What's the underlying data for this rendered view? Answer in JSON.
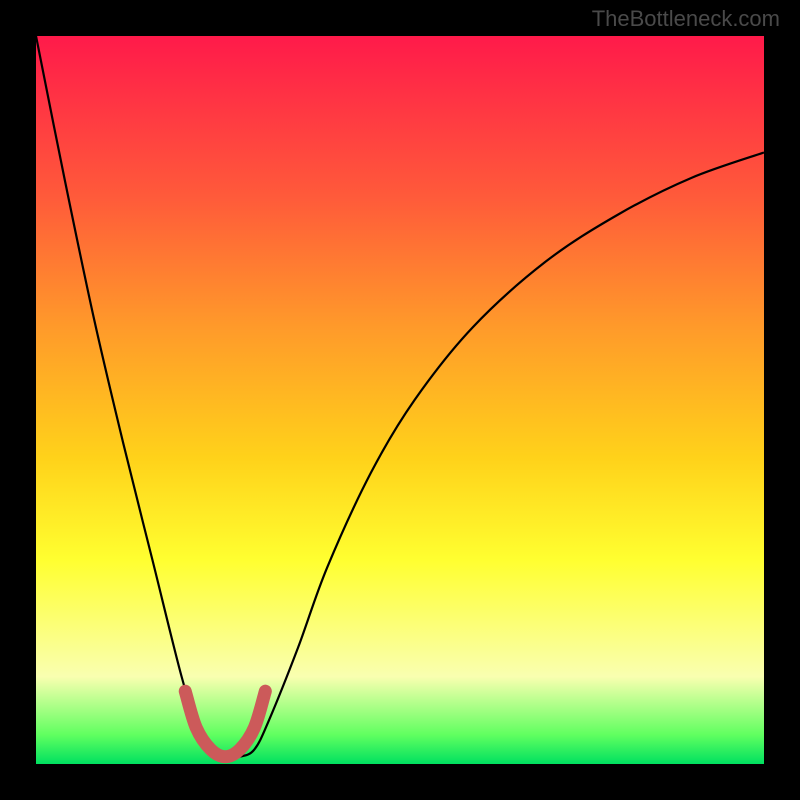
{
  "watermark": "TheBottleneck.com",
  "chart_data": {
    "type": "line",
    "title": "",
    "xlabel": "",
    "ylabel": "",
    "xlim": [
      0,
      100
    ],
    "ylim": [
      0,
      100
    ],
    "grid": false,
    "legend": false,
    "series": [
      {
        "name": "bottleneck-curve",
        "color": "#000000",
        "x": [
          0,
          4,
          8,
          12,
          16,
          20,
          22,
          24,
          26,
          28,
          30,
          32,
          36,
          40,
          46,
          52,
          60,
          70,
          80,
          90,
          100
        ],
        "y": [
          100,
          80,
          61,
          44,
          28,
          12,
          6,
          2,
          1,
          1,
          2,
          6,
          16,
          27,
          40,
          50,
          60,
          69,
          75.5,
          80.5,
          84
        ]
      },
      {
        "name": "highlight-band",
        "color": "#cc5a5a",
        "x": [
          20.5,
          22,
          24,
          26,
          28,
          30,
          31.5
        ],
        "y": [
          10,
          5,
          2,
          1,
          2,
          5,
          10
        ]
      }
    ],
    "gradient_stops": [
      {
        "pos": 0,
        "color": "#ff1a4a"
      },
      {
        "pos": 22,
        "color": "#ff5a3a"
      },
      {
        "pos": 40,
        "color": "#ff9a2a"
      },
      {
        "pos": 58,
        "color": "#ffd21a"
      },
      {
        "pos": 72,
        "color": "#ffff30"
      },
      {
        "pos": 88,
        "color": "#f9ffb0"
      },
      {
        "pos": 96,
        "color": "#60ff60"
      },
      {
        "pos": 100,
        "color": "#00e060"
      }
    ]
  }
}
